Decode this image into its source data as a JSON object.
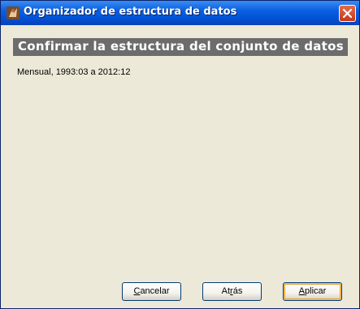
{
  "window": {
    "title": "Organizador de estructura de datos",
    "icon": "gretl-app-icon",
    "close_icon": "close-icon"
  },
  "content": {
    "heading": "Confirmar la estructura del conjunto de datos",
    "summary": "Mensual, 1993:03 a 2012:12"
  },
  "buttons": {
    "cancel": {
      "mnemonic": "C",
      "rest": "ancelar"
    },
    "back": {
      "pre": "At",
      "mnemonic": "r",
      "rest": "ás"
    },
    "apply": {
      "mnemonic": "A",
      "rest": "plicar"
    }
  },
  "colors": {
    "titlebar": "#0a5fe0",
    "window_bg": "#ece9d8",
    "heading_bg": "#6d6c6c",
    "close_bg": "#c4381b",
    "default_button_ring": "#e5a036"
  }
}
